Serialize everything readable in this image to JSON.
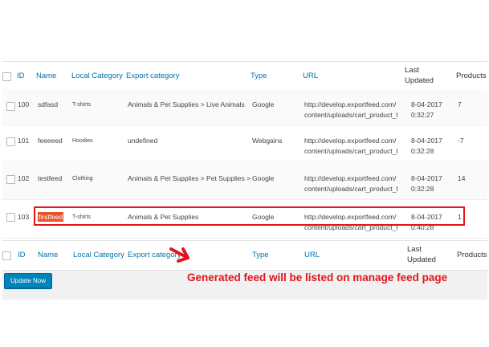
{
  "columns": {
    "id": "ID",
    "name": "Name",
    "local_category": "Local Category",
    "export_category": "Export category",
    "type": "Type",
    "url": "URL",
    "last_updated_1": "Last",
    "last_updated_2": "Updated",
    "products": "Products"
  },
  "rows": [
    {
      "id": "100",
      "name": "sdfasd",
      "local_category": "T-shirts",
      "export_category": "Animals & Pet Supplies > Live Animals",
      "type": "Google",
      "url_1": "http://develop.exportfeed.com/",
      "url_2": "content/uploads/cart_product_f",
      "date": "8-04-2017",
      "time": "0:32:27",
      "products": "7"
    },
    {
      "id": "101",
      "name": "feeeeed",
      "local_category": "Hoodies",
      "export_category": "undefined",
      "type": "Webgains",
      "url_1": "http://develop.exportfeed.com/",
      "url_2": "content/uploads/cart_product_f",
      "date": "8-04-2017",
      "time": "0:32:28",
      "products": "-7"
    },
    {
      "id": "102",
      "name": "testfeed",
      "local_category": "Clothing",
      "export_category": "Animals & Pet Supplies > Pet Supplies >",
      "type": "Google",
      "url_1": "http://develop.exportfeed.com/",
      "url_2": "content/uploads/cart_product_f",
      "date": "8-04-2017",
      "time": "0:32:28",
      "products": "14"
    },
    {
      "id": "103",
      "name": "firstfeed",
      "local_category": "T-shirts",
      "export_category": "Animals & Pet Supplies",
      "type": "Google",
      "url_1": "http://develop.exportfeed.com/",
      "url_2": "content/uploads/cart_product_f",
      "date": "8-04-2017",
      "time": "0:40:28",
      "products": "1"
    }
  ],
  "update_button": "Update Now",
  "annotation": "Generated feed will be listed on manage feed page",
  "colors": {
    "link": "#0073aa",
    "button": "#0085ba",
    "annotation": "#e3141b",
    "highlight": "#e2542b"
  }
}
